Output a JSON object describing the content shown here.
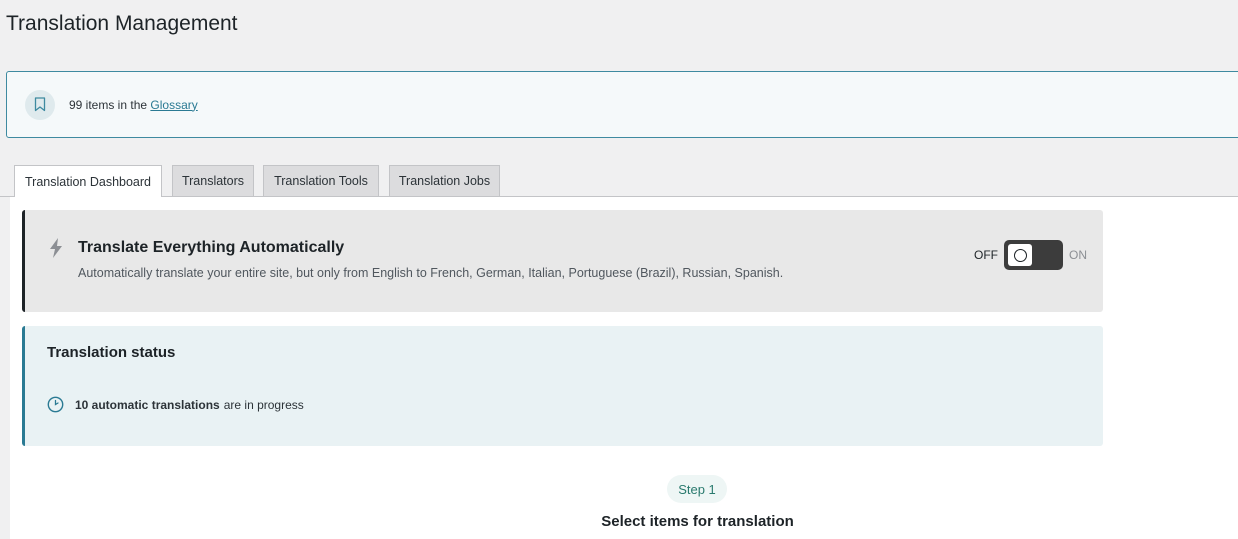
{
  "page": {
    "title": "Translation Management"
  },
  "glossary": {
    "icon": "bookmark-icon",
    "count_text": "99 items in the",
    "link_label": "Glossary"
  },
  "tabs": [
    {
      "label": "Translation Dashboard",
      "active": true
    },
    {
      "label": "Translators",
      "active": false
    },
    {
      "label": "Translation Tools",
      "active": false
    },
    {
      "label": "Translation Jobs",
      "active": false
    }
  ],
  "auto_translate": {
    "icon": "lightning-bolt-icon",
    "title": "Translate Everything Automatically",
    "description": "Automatically translate your entire site, but only from English to French, German, Italian, Portuguese (Brazil), Russian, Spanish.",
    "toggle_off_label": "OFF",
    "toggle_on_label": "ON",
    "enabled": false
  },
  "status": {
    "title": "Translation status",
    "icon": "progress-circle-icon",
    "highlight": "10 automatic translations",
    "suffix": "are in progress"
  },
  "step": {
    "badge": "Step 1",
    "title": "Select items for translation"
  },
  "colors": {
    "accent": "#2a7a93",
    "step_text": "#2a7a6e",
    "toggle_bg": "#3c3c3c"
  }
}
